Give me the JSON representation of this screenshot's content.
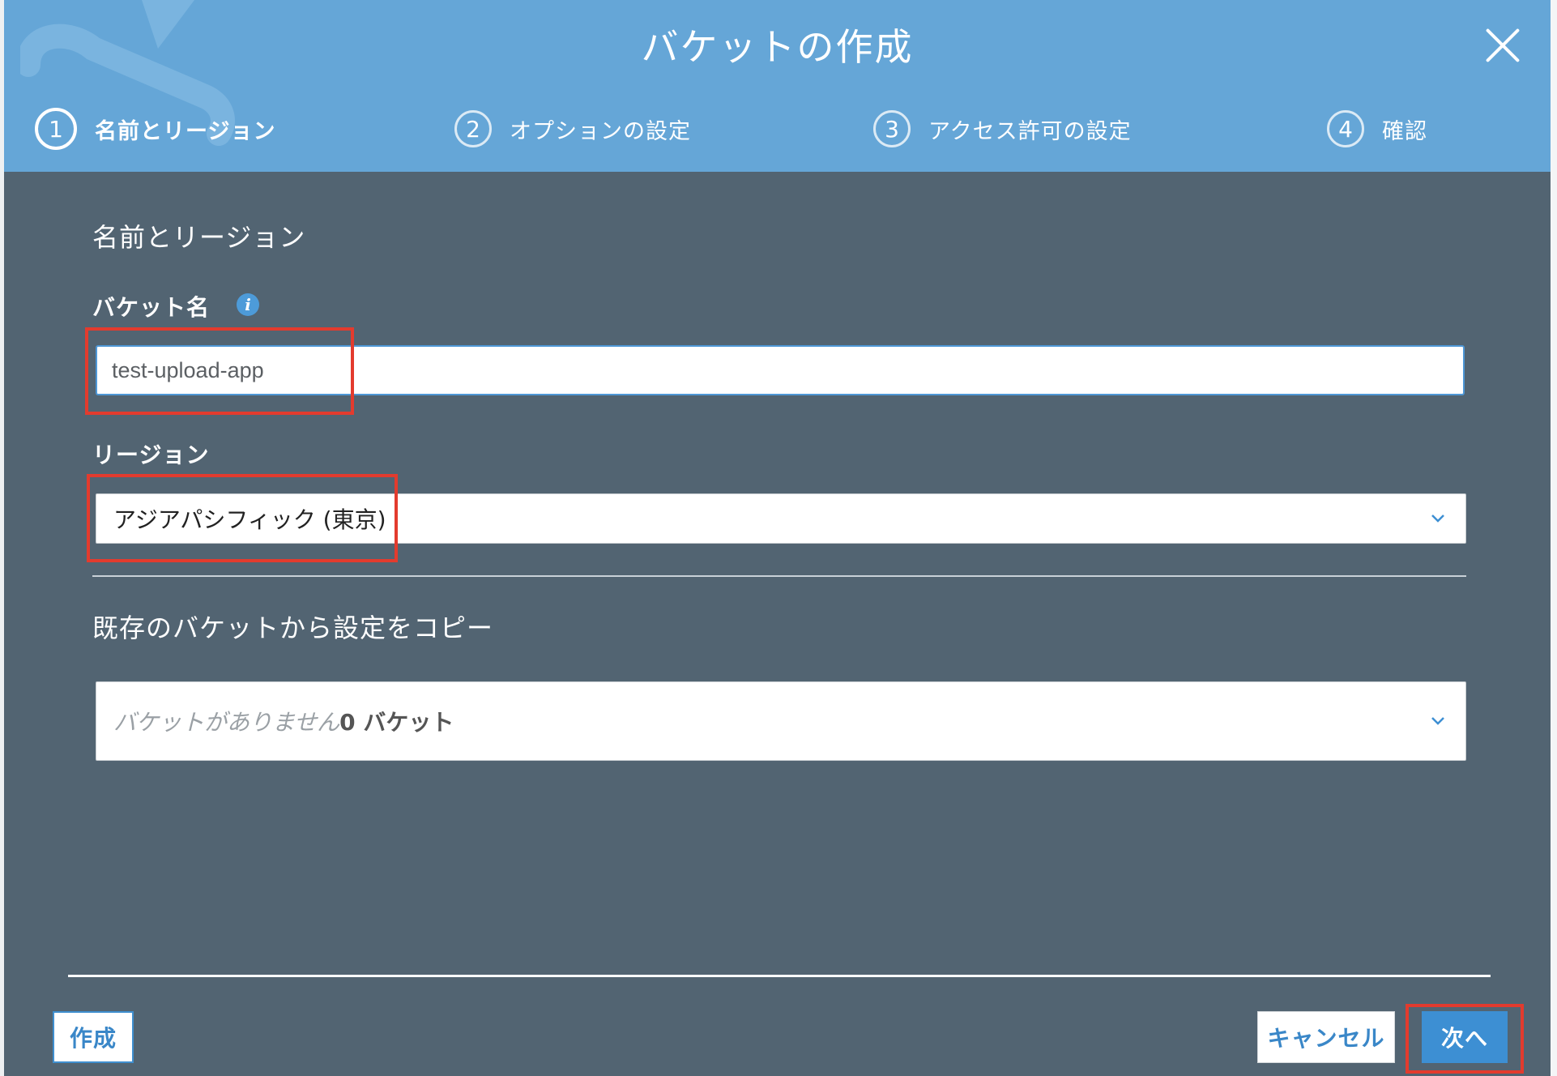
{
  "dialog": {
    "title": "バケットの作成",
    "close_icon": "close-icon"
  },
  "steps": [
    {
      "number": "1",
      "label": "名前とリージョン",
      "active": true
    },
    {
      "number": "2",
      "label": "オプションの設定",
      "active": false
    },
    {
      "number": "3",
      "label": "アクセス許可の設定",
      "active": false
    },
    {
      "number": "4",
      "label": "確認",
      "active": false
    }
  ],
  "form": {
    "section_title": "名前とリージョン",
    "bucket_name_label": "バケット名",
    "bucket_name_value": "test-upload-app",
    "info_icon": "info-icon",
    "region_label": "リージョン",
    "region_value": "アジアパシフィック (東京)",
    "copy_section_title": "既存のバケットから設定をコピー",
    "copy_placeholder": "バケットがありません",
    "copy_count": "0 バケット"
  },
  "footer": {
    "create_label": "作成",
    "cancel_label": "キャンセル",
    "next_label": "次へ"
  },
  "colors": {
    "header": "#65a6d7",
    "body": "#526472",
    "accent": "#3d8fd3",
    "highlight": "#e33b2e"
  }
}
